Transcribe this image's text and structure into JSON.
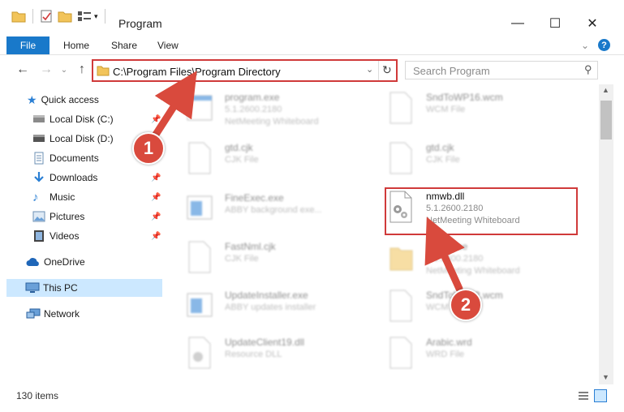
{
  "window": {
    "title": "Program",
    "minimize_glyph": "—",
    "maximize_glyph": "☐",
    "close_glyph": "✕"
  },
  "ribbon": {
    "tabs": [
      "File",
      "Home",
      "Share",
      "View"
    ],
    "help_glyph": "?"
  },
  "address": {
    "path": "C:\\Program Files\\Program Directory",
    "search_placeholder": "Search Program"
  },
  "sidebar": {
    "quick_access": "Quick access",
    "items": [
      {
        "label": "Local Disk (C:)",
        "icon": "drive-icon",
        "pinned": true
      },
      {
        "label": "Local Disk (D:)",
        "icon": "drive-icon",
        "pinned": true
      },
      {
        "label": "Documents",
        "icon": "documents-icon",
        "pinned": true
      },
      {
        "label": "Downloads",
        "icon": "download-icon",
        "pinned": true
      },
      {
        "label": "Music",
        "icon": "music-icon",
        "pinned": true
      },
      {
        "label": "Pictures",
        "icon": "pictures-icon",
        "pinned": true
      },
      {
        "label": "Videos",
        "icon": "videos-icon",
        "pinned": true
      }
    ],
    "onedrive": "OneDrive",
    "this_pc": "This PC",
    "network": "Network"
  },
  "files": [
    {
      "name": "program.exe",
      "line1": "5.1.2600.2180",
      "line2": "NetMeeting Whiteboard",
      "icon": "exe"
    },
    {
      "name": "SndToWP16.wcm",
      "line1": "WCM File",
      "line2": "",
      "icon": "doc"
    },
    {
      "name": "gtd.cjk",
      "line1": "CJK File",
      "line2": "",
      "icon": "doc"
    },
    {
      "name": "gtd.cjk",
      "line1": "CJK File",
      "line2": "",
      "icon": "doc"
    },
    {
      "name": "FineExec.exe",
      "line1": "ABBY background exe...",
      "line2": "",
      "icon": "app"
    },
    {
      "name": "nmwb.dll",
      "line1": "5.1.2600.2180",
      "line2": "NetMeeting Whiteboard",
      "icon": "dll"
    },
    {
      "name": "FastNml.cjk",
      "line1": "CJK File",
      "line2": "",
      "icon": "doc"
    },
    {
      "name": "Resource",
      "line1": "5.1.2600.2180",
      "line2": "NetMeeting Whiteboard",
      "icon": "exe"
    },
    {
      "name": "UpdateInstaller.exe",
      "line1": "ABBY updates installer",
      "line2": "",
      "icon": "app"
    },
    {
      "name": "SndToWP32.wcm",
      "line1": "WCM File",
      "line2": "",
      "icon": "doc"
    },
    {
      "name": "UpdateClient19.dll",
      "line1": "Resource DLL",
      "line2": "",
      "icon": "dll"
    },
    {
      "name": "Arabic.wrd",
      "line1": "WRD File",
      "line2": "",
      "icon": "doc"
    }
  ],
  "status": {
    "count": "130 items"
  },
  "callouts": [
    "1",
    "2"
  ],
  "colors": {
    "accent": "#1979ca",
    "highlight": "#d03a3a",
    "callout": "#d94a3d",
    "selected": "#cce8ff"
  }
}
